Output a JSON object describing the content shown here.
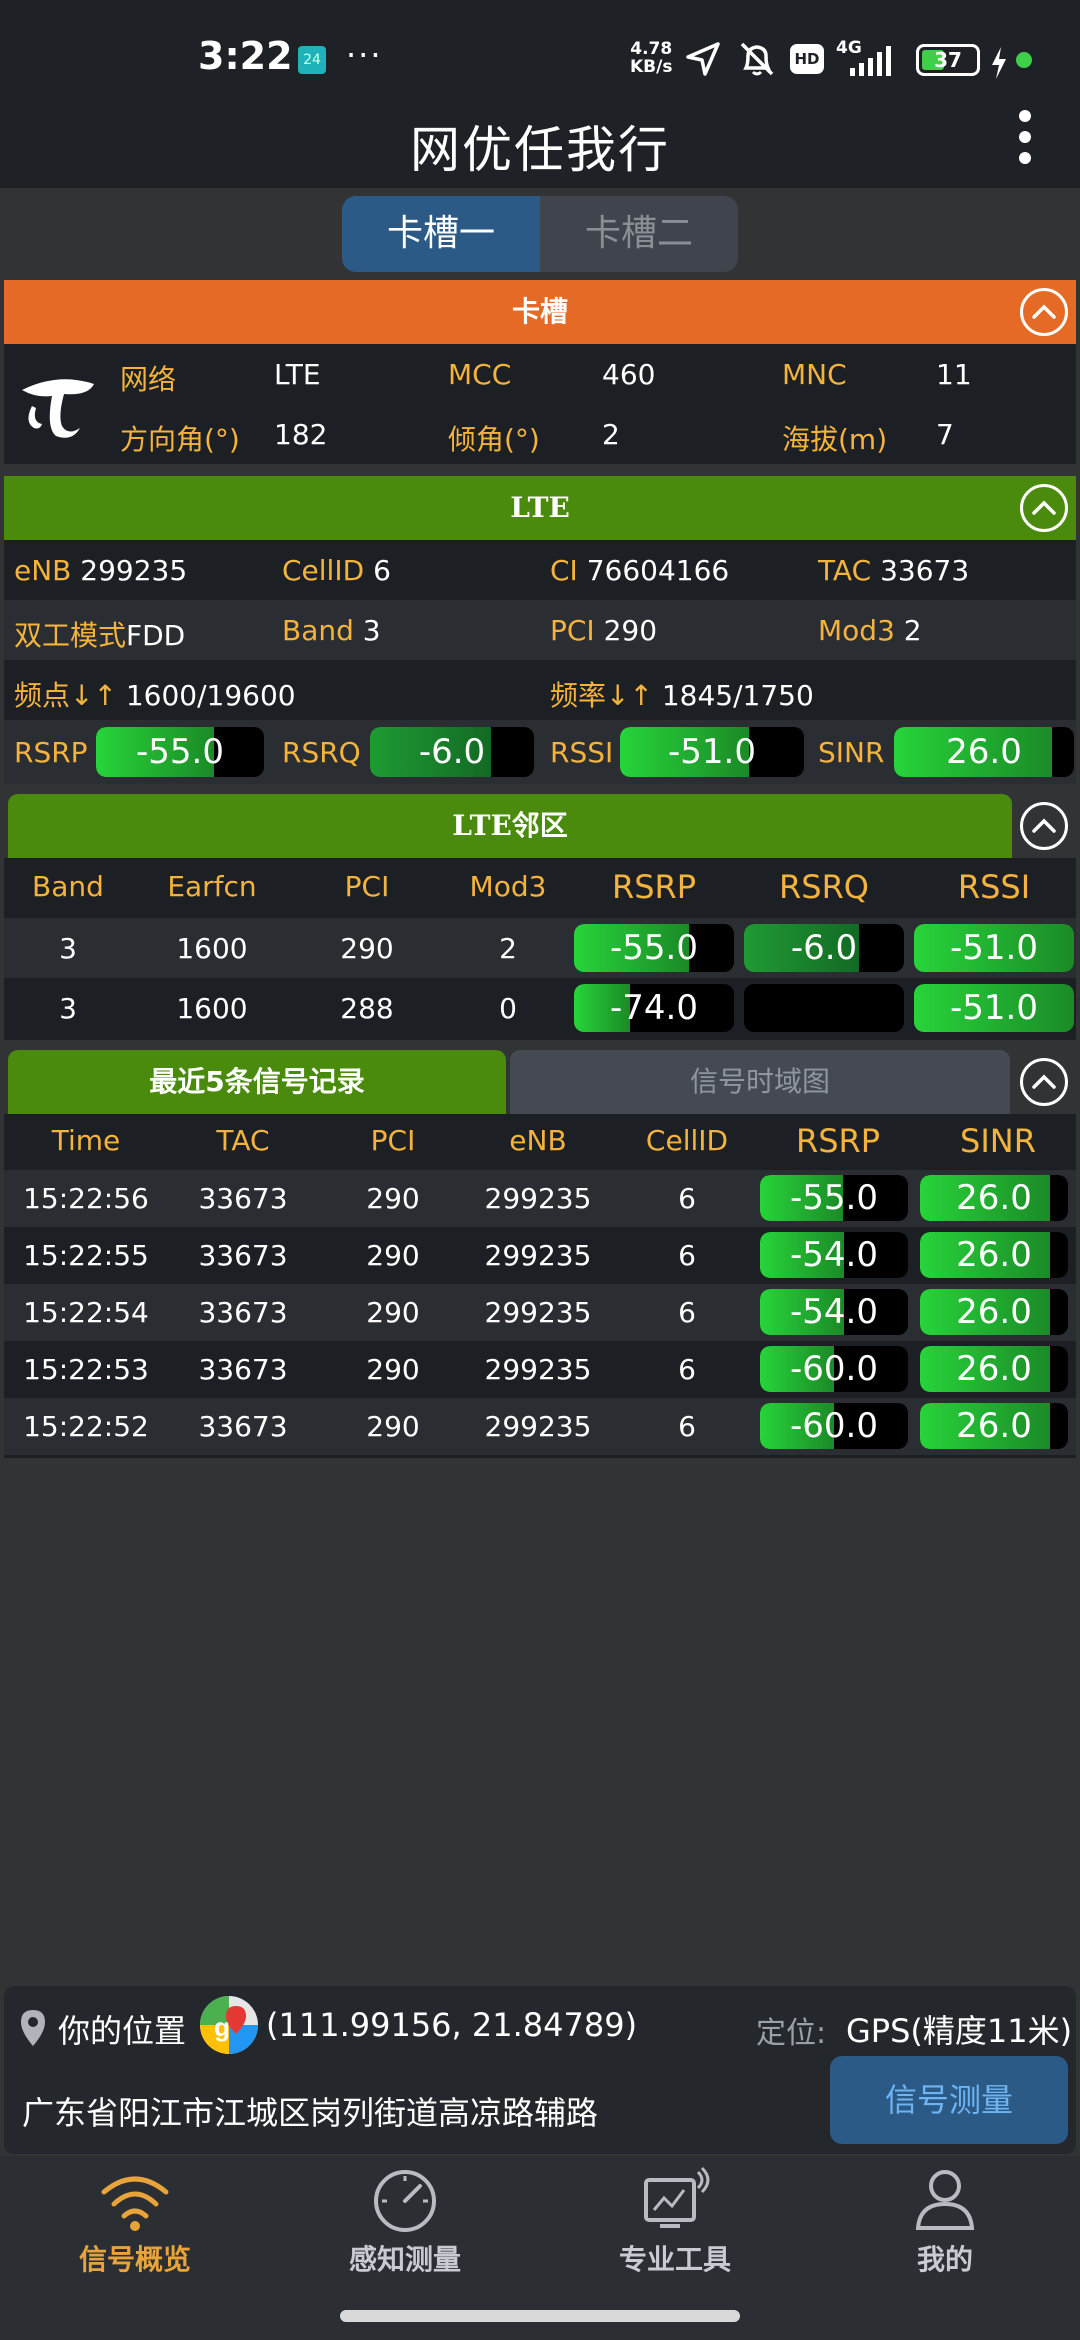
{
  "status_bar": {
    "time": "3:22",
    "notif_badge": "24",
    "more": "···",
    "speed_value": "4.78",
    "speed_unit": "KB/s",
    "hd": "HD",
    "net": "4G",
    "battery": "37"
  },
  "app": {
    "title": "网优任我行"
  },
  "slots": {
    "slot1": "卡槽一",
    "slot2": "卡槽二"
  },
  "sim_section": {
    "header": "卡槽",
    "rows": {
      "network_label": "网络",
      "network": "LTE",
      "mcc_label": "MCC",
      "mcc": "460",
      "mnc_label": "MNC",
      "mnc": "11",
      "azimuth_label": "方向角(°)",
      "azimuth": "182",
      "tilt_label": "倾角(°)",
      "tilt": "2",
      "altitude_label": "海拔(m)",
      "altitude": "7"
    }
  },
  "lte_section": {
    "header": "LTE",
    "enb_label": "eNB",
    "enb": "299235",
    "cellid_label": "CellID",
    "cellid": "6",
    "ci_label": "CI",
    "ci": "76604166",
    "tac_label": "TAC",
    "tac": "33673",
    "duplex_label": "双工模式",
    "duplex": "FDD",
    "band_label": "Band",
    "band": "3",
    "pci_label": "PCI",
    "pci": "290",
    "mod3_label": "Mod3",
    "mod3": "2",
    "earfcn_label": "频点↓↑",
    "earfcn": "1600/19600",
    "freq_label": "频率↓↑",
    "freq": "1845/1750",
    "metrics": [
      {
        "label": "RSRP",
        "value": "-55.0",
        "level": 0.7
      },
      {
        "label": "RSRQ",
        "value": "-6.0",
        "level": 0.74
      },
      {
        "label": "RSSI",
        "value": "-51.0",
        "level": 0.7
      },
      {
        "label": "SINR",
        "value": "26.0",
        "level": 0.88
      }
    ]
  },
  "neighbor_section": {
    "header": "LTE邻区",
    "columns": [
      "Band",
      "Earfcn",
      "PCI",
      "Mod3",
      "RSRP",
      "RSRQ",
      "RSSI"
    ],
    "rows": [
      {
        "band": "3",
        "earfcn": "1600",
        "pci": "290",
        "mod3": "2",
        "rsrp": "-55.0",
        "rsrp_level": 0.72,
        "rsrq": "-6.0",
        "rsrq_level": 0.72,
        "rssi": "-51.0",
        "rssi_level": 1.0
      },
      {
        "band": "3",
        "earfcn": "1600",
        "pci": "288",
        "mod3": "0",
        "rsrp": "-74.0",
        "rsrp_level": 0.35,
        "rsrq": "",
        "rsrq_level": 0,
        "rssi": "-51.0",
        "rssi_level": 1.0
      }
    ]
  },
  "records_section": {
    "tab_active": "最近5条信号记录",
    "tab_inactive": "信号时域图",
    "columns": [
      "Time",
      "TAC",
      "PCI",
      "eNB",
      "CellID",
      "RSRP",
      "SINR"
    ],
    "rows": [
      {
        "time": "15:22:56",
        "tac": "33673",
        "pci": "290",
        "enb": "299235",
        "cellid": "6",
        "rsrp": "-55.0",
        "rsrp_level": 0.56,
        "sinr": "26.0",
        "sinr_level": 0.88
      },
      {
        "time": "15:22:55",
        "tac": "33673",
        "pci": "290",
        "enb": "299235",
        "cellid": "6",
        "rsrp": "-54.0",
        "rsrp_level": 0.57,
        "sinr": "26.0",
        "sinr_level": 0.88
      },
      {
        "time": "15:22:54",
        "tac": "33673",
        "pci": "290",
        "enb": "299235",
        "cellid": "6",
        "rsrp": "-54.0",
        "rsrp_level": 0.57,
        "sinr": "26.0",
        "sinr_level": 0.88
      },
      {
        "time": "15:22:53",
        "tac": "33673",
        "pci": "290",
        "enb": "299235",
        "cellid": "6",
        "rsrp": "-60.0",
        "rsrp_level": 0.5,
        "sinr": "26.0",
        "sinr_level": 0.88
      },
      {
        "time": "15:22:52",
        "tac": "33673",
        "pci": "290",
        "enb": "299235",
        "cellid": "6",
        "rsrp": "-60.0",
        "rsrp_level": 0.5,
        "sinr": "26.0",
        "sinr_level": 0.88
      }
    ]
  },
  "location": {
    "label": "你的位置",
    "coords": "(111.99156, 21.84789)",
    "fix_label": "定位:",
    "fix_value": "GPS(精度11米)",
    "address": "广东省阳江市江城区岗列街道高凉路辅路",
    "measure_button": "信号测量"
  },
  "nav": {
    "items": [
      {
        "label": "信号概览",
        "active": true
      },
      {
        "label": "感知测量",
        "active": false
      },
      {
        "label": "专业工具",
        "active": false
      },
      {
        "label": "我的",
        "active": false
      }
    ]
  },
  "colors": {
    "accent_orange": "#e46a25",
    "lte_green": "#4a8a0c",
    "label_gold": "#f4b33d",
    "active_nav": "#e8a33a"
  }
}
